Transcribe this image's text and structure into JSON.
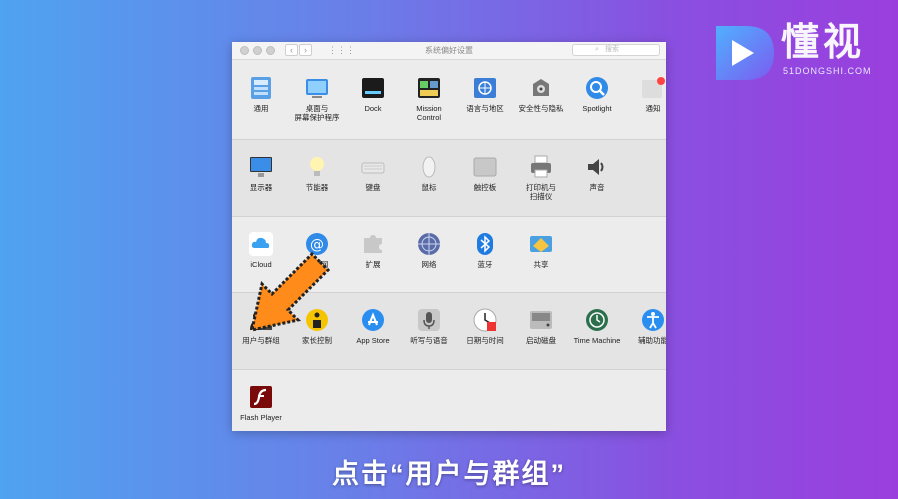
{
  "window": {
    "title": "系统偏好设置",
    "search_placeholder": "搜索",
    "nav_back": "‹",
    "nav_forward": "›",
    "grid": "⋮⋮⋮"
  },
  "rows": [
    [
      "通用",
      "桌面与\n屏幕保护程序",
      "Dock",
      "Mission\nControl",
      "语言与地区",
      "安全性与隐私",
      "Spotlight",
      "通知"
    ],
    [
      "显示器",
      "节能器",
      "键盘",
      "鼠标",
      "触控板",
      "打印机与\n扫描仪",
      "声音"
    ],
    [
      "iCloud",
      "互联网\n帐户",
      "扩展",
      "网络",
      "蓝牙",
      "共享"
    ],
    [
      "用户与群组",
      "家长控制",
      "App Store",
      "听写与语音",
      "日期与时间",
      "启动磁盘",
      "Time Machine",
      "辅助功能"
    ],
    [
      "Flash Player"
    ]
  ],
  "icons": [
    [
      "general-icon",
      "desktop-icon",
      "dock-icon",
      "mission-control-icon",
      "language-icon",
      "security-icon",
      "spotlight-icon",
      "notifications-icon"
    ],
    [
      "display-icon",
      "energy-saver-icon",
      "keyboard-icon",
      "mouse-icon",
      "trackpad-icon",
      "printer-icon",
      "sound-icon"
    ],
    [
      "icloud-icon",
      "internet-accounts-icon",
      "extensions-icon",
      "network-icon",
      "bluetooth-icon",
      "sharing-icon"
    ],
    [
      "users-groups-icon",
      "parental-controls-icon",
      "app-store-icon",
      "dictation-icon",
      "date-time-icon",
      "startup-disk-icon",
      "time-machine-icon",
      "accessibility-icon"
    ],
    [
      "flash-player-icon"
    ]
  ],
  "watermark": {
    "brand": "懂视",
    "site": "51DONGSHI.COM",
    "colors": [
      "#4fb0ff",
      "#7b5cf0"
    ]
  },
  "caption": "点击“用户与群组”",
  "accent": "#ff8c1a"
}
